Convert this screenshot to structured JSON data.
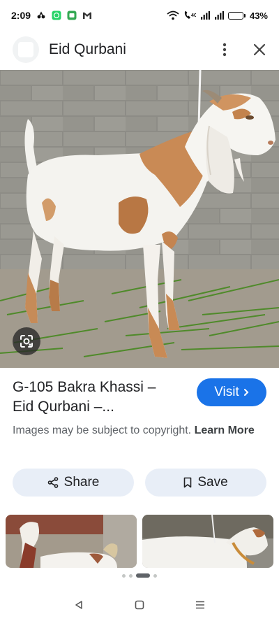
{
  "status_bar": {
    "time": "2:09",
    "battery_percent": "43%",
    "battery_level": 0.43,
    "icons": [
      "notification-icon",
      "whatsapp-icon",
      "message-icon",
      "gmail-icon",
      "wifi-icon",
      "call-icon",
      "signal-icon",
      "signal-icon",
      "battery-icon"
    ]
  },
  "header": {
    "title": "Eid Qurbani",
    "menu_icon": "more-vert-icon",
    "close_icon": "close-icon"
  },
  "result": {
    "title": "G-105 Bakra Khassi –\nEid Qurbani –...",
    "visit_label": "Visit",
    "copyright_text": "Images may be subject to copyright.",
    "learn_more_label": "Learn More"
  },
  "actions": {
    "share_label": "Share",
    "save_label": "Save"
  },
  "pager": {
    "dots": 4,
    "active_index": 2
  },
  "colors": {
    "accent": "#1a73e8",
    "pill_bg": "#e8eef7",
    "battery_fill": "#f2b400"
  }
}
